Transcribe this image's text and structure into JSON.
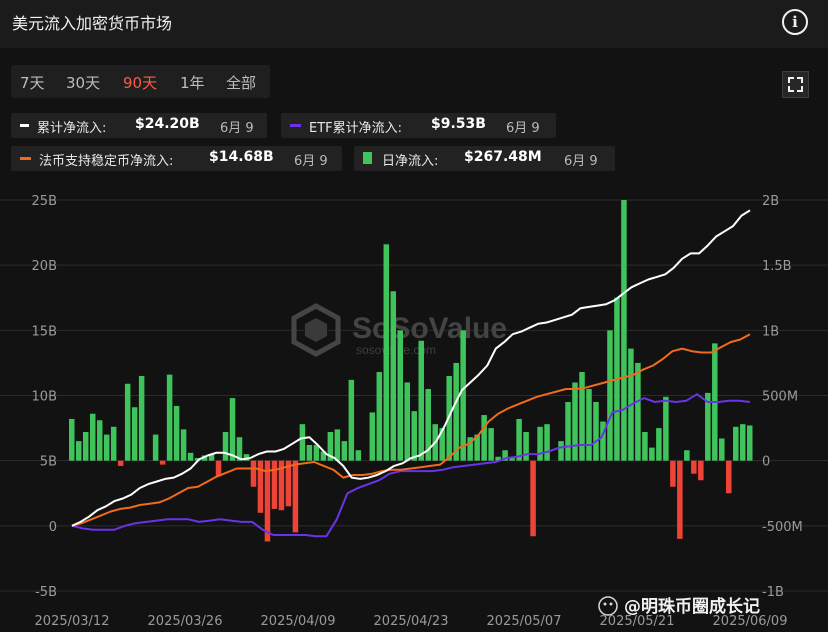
{
  "header": {
    "title": "美元流入加密货币市场"
  },
  "tabs": [
    {
      "label": "7天",
      "active": false
    },
    {
      "label": "30天",
      "active": false
    },
    {
      "label": "90天",
      "active": true
    },
    {
      "label": "1年",
      "active": false
    },
    {
      "label": "全部",
      "active": false
    }
  ],
  "legend": [
    {
      "label": "累计净流入:",
      "value": "$24.20B",
      "date": "6月 9",
      "color": "#ffffff"
    },
    {
      "label": "ETF累计净流入:",
      "value": "$9.53B",
      "date": "6月 9",
      "color": "#6a34e6"
    },
    {
      "label": "法币支持稳定币净流入:",
      "value": "$14.68B",
      "date": "6月 9",
      "color": "#f26a1b"
    },
    {
      "label": "日净流入:",
      "value": "$267.48M",
      "date": "6月 9",
      "color": "#3fc45c"
    }
  ],
  "watermark": {
    "logo_text": "SoSoValue",
    "url": "sosovalue.com"
  },
  "source_tag": "@明珠币圈成长记",
  "colors": {
    "pos_bar": "#3fc45c",
    "neg_bar": "#ee4438",
    "total": "#ffffff",
    "etf": "#6a34e6",
    "stable": "#f26a1b",
    "grid": "#2c2c2c",
    "axis_text": "#9a9a9a"
  },
  "chart_data": {
    "type": "bar",
    "x_labels": [
      "2025/03/12",
      "2025/03/26",
      "2025/04/09",
      "2025/04/23",
      "2025/05/07",
      "2025/05/21",
      "2025/06/09"
    ],
    "y_left": {
      "ticks": [
        "25B",
        "20B",
        "15B",
        "10B",
        "5B",
        "0",
        "-5B"
      ],
      "min": -5,
      "max": 25,
      "unit": "B"
    },
    "y_right": {
      "ticks": [
        "2B",
        "1.5B",
        "1B",
        "500M",
        "0",
        "-500M",
        "-1B"
      ],
      "min": -1,
      "max": 2,
      "unit": "B"
    },
    "grid": true,
    "series": [
      {
        "name": "日净流入",
        "type": "bar",
        "axis": "right",
        "values": [
          0.32,
          0.15,
          0.22,
          0.36,
          0.31,
          0.2,
          0.26,
          -0.04,
          0.59,
          0.41,
          0.65,
          0.0,
          0.2,
          -0.03,
          0.66,
          0.42,
          0.24,
          0.06,
          0.02,
          0.04,
          0.05,
          -0.12,
          0.22,
          0.48,
          0.18,
          0.05,
          -0.2,
          -0.4,
          -0.62,
          -0.37,
          -0.38,
          -0.35,
          -0.55,
          0.28,
          0.12,
          0.12,
          0.07,
          0.22,
          0.24,
          0.15,
          0.62,
          0.08,
          0.0,
          0.37,
          0.68,
          1.66,
          1.3,
          1.0,
          0.6,
          0.38,
          0.92,
          0.55,
          0.28,
          0.25,
          0.65,
          0.75,
          1.0,
          0.18,
          0.2,
          0.35,
          0.25,
          0.03,
          0.08,
          0.02,
          0.32,
          0.22,
          -0.58,
          0.26,
          0.28,
          0.0,
          0.15,
          0.45,
          0.6,
          0.68,
          0.55,
          0.45,
          0.3,
          1.0,
          1.25,
          2.0,
          0.86,
          0.75,
          0.22,
          0.1,
          0.25,
          0.49,
          -0.2,
          -0.6,
          0.08,
          -0.1,
          -0.15,
          0.52,
          0.9,
          0.17,
          -0.25,
          0.26,
          0.28,
          0.27
        ]
      },
      {
        "name": "累计净流入",
        "type": "line",
        "axis": "left",
        "values": [
          0,
          0.3,
          0.7,
          1.2,
          1.5,
          1.9,
          2.1,
          2.4,
          2.9,
          3.2,
          3.4,
          3.6,
          3.7,
          4.0,
          4.4,
          5.1,
          5.4,
          5.6,
          5.6,
          5.4,
          5.1,
          5.2,
          5.5,
          5.7,
          5.7,
          5.9,
          6.3,
          6.7,
          6.8,
          6.2,
          5.5,
          5.2,
          4.6,
          3.7,
          3.6,
          3.7,
          3.9,
          4.2,
          4.6,
          4.8,
          5.2,
          5.4,
          5.8,
          6.5,
          7.7,
          9.1,
          10.4,
          11.0,
          11.6,
          12.3,
          13.6,
          14.1,
          14.7,
          14.9,
          15.2,
          15.5,
          15.6,
          15.8,
          16.0,
          16.2,
          16.7,
          16.8,
          16.9,
          17.0,
          17.3,
          17.8,
          18.3,
          18.6,
          18.9,
          19.1,
          19.3,
          19.8,
          20.5,
          20.9,
          20.9,
          21.5,
          22.2,
          22.6,
          23.0,
          23.8,
          24.2
        ]
      },
      {
        "name": "ETF累计净流入",
        "type": "line",
        "axis": "left",
        "values": [
          0,
          -0.2,
          -0.3,
          -0.3,
          -0.3,
          0.0,
          0.2,
          0.3,
          0.4,
          0.5,
          0.5,
          0.5,
          0.3,
          0.4,
          0.5,
          0.4,
          0.3,
          0.3,
          -0.3,
          -0.7,
          -0.7,
          -0.7,
          -0.7,
          -0.8,
          -0.8,
          0.5,
          2.5,
          2.9,
          3.2,
          3.5,
          4.0,
          4.2,
          4.2,
          4.2,
          4.2,
          4.3,
          4.5,
          4.6,
          4.7,
          4.8,
          4.9,
          5.2,
          5.3,
          5.5,
          5.5,
          5.7,
          6.0,
          6.1,
          6.2,
          6.2,
          6.8,
          8.7,
          8.9,
          9.4,
          9.8,
          9.5,
          9.6,
          9.5,
          9.6,
          10.1,
          9.5,
          9.5,
          9.6,
          9.6,
          9.5
        ]
      },
      {
        "name": "法币支持稳定币净流入",
        "type": "line",
        "axis": "left",
        "values": [
          0,
          0.2,
          0.5,
          0.8,
          1.1,
          1.3,
          1.4,
          1.6,
          1.7,
          1.8,
          2.1,
          2.5,
          2.9,
          3.0,
          3.4,
          3.8,
          4.1,
          4.4,
          4.4,
          4.4,
          4.2,
          4.3,
          4.5,
          4.7,
          4.8,
          4.9,
          4.6,
          4.3,
          3.7,
          3.9,
          3.9,
          4.0,
          4.2,
          4.3,
          4.3,
          4.4,
          4.5,
          4.6,
          4.7,
          5.3,
          6.0,
          6.3,
          7.0,
          8.0,
          8.6,
          9.0,
          9.3,
          9.6,
          9.9,
          10.1,
          10.3,
          10.5,
          10.5,
          10.6,
          10.8,
          11.0,
          11.2,
          11.4,
          11.6,
          12.0,
          12.3,
          12.8,
          13.4,
          13.6,
          13.4,
          13.3,
          13.3,
          13.7,
          14.1,
          14.3,
          14.7
        ]
      }
    ]
  }
}
